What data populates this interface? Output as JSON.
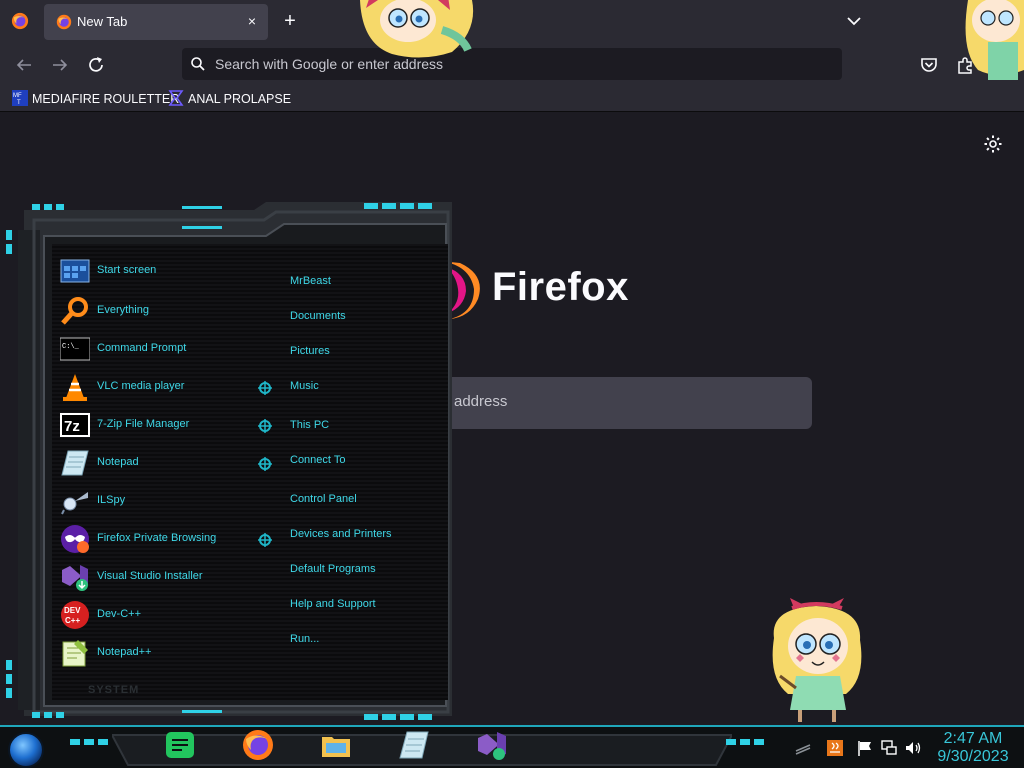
{
  "browser": {
    "tab": {
      "title": "New Tab",
      "close_glyph": "×"
    },
    "new_tab_glyph": "+",
    "urlbar_placeholder": "Search with Google or enter address",
    "bookmarks": [
      {
        "label": "MEDIAFIRE ROULETTER",
        "icon": "mediafire-icon"
      },
      {
        "label": "ANAL PROLAPSE",
        "icon": "sigma-bookmark-icon"
      }
    ]
  },
  "newtab": {
    "wordmark": "Firefox",
    "search_placeholder_visible": "address"
  },
  "start_menu": {
    "programs": [
      {
        "label": "Start screen",
        "icon": "start-screen-icon"
      },
      {
        "label": "Everything",
        "icon": "magnifier-icon"
      },
      {
        "label": "Command Prompt",
        "icon": "command-prompt-icon"
      },
      {
        "label": "VLC media player",
        "icon": "vlc-cone-icon"
      },
      {
        "label": "7-Zip File Manager",
        "icon": "7zip-icon"
      },
      {
        "label": "Notepad",
        "icon": "notepad-icon"
      },
      {
        "label": "ILSpy",
        "icon": "ilspy-icon"
      },
      {
        "label": "Firefox Private Browsing",
        "icon": "private-browsing-icon"
      },
      {
        "label": "Visual Studio Installer",
        "icon": "vs-installer-icon"
      },
      {
        "label": "Dev-C++",
        "icon": "devcpp-icon"
      },
      {
        "label": "Notepad++",
        "icon": "notepadpp-icon"
      }
    ],
    "places": [
      {
        "label": "MrBeast"
      },
      {
        "label": "Documents"
      },
      {
        "label": "Pictures"
      },
      {
        "label": "Music"
      },
      {
        "label": "This PC"
      },
      {
        "label": "Connect To"
      },
      {
        "label": "Control Panel"
      },
      {
        "label": "Devices and Printers"
      },
      {
        "label": "Default Programs"
      },
      {
        "label": "Help and Support"
      },
      {
        "label": "Run..."
      }
    ],
    "system_label": "SYSTEM"
  },
  "taskbar": {
    "apps": [
      {
        "icon": "notes-app-icon"
      },
      {
        "icon": "firefox-icon"
      },
      {
        "icon": "file-explorer-icon"
      },
      {
        "icon": "notepad-icon"
      },
      {
        "icon": "vs-installer-icon"
      }
    ],
    "time": "2:47 AM",
    "date": "9/30/2023"
  },
  "colors": {
    "accent_cyan": "#3fd8e8",
    "browser_chrome": "#2b2a33",
    "page_bg": "#1c1b22"
  }
}
